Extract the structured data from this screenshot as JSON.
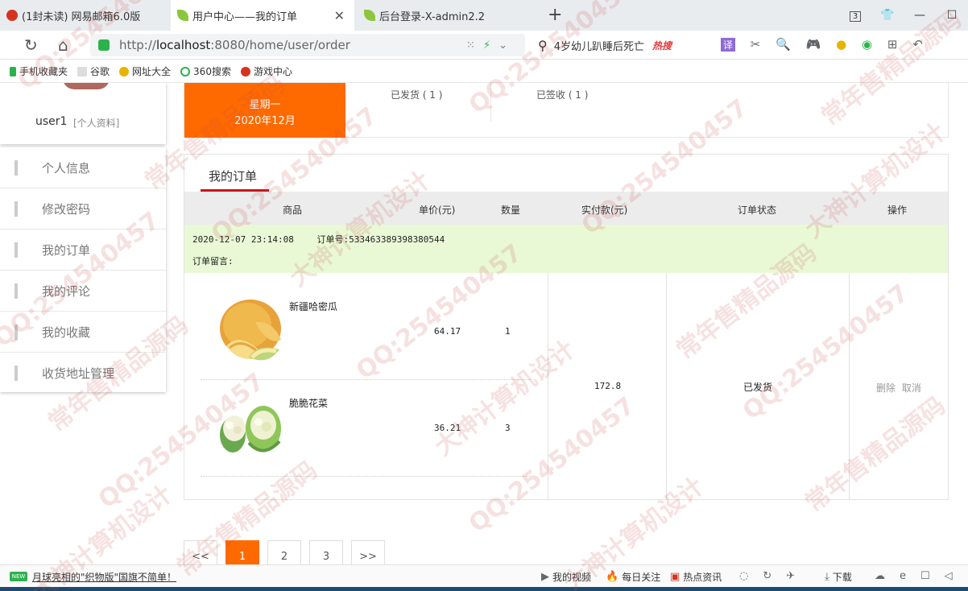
{
  "browser": {
    "tabs": [
      {
        "title": "(1封未读) 网易邮箱6.0版"
      },
      {
        "title": "用户中心——我的订单"
      },
      {
        "title": "后台登录-X-admin2.2"
      }
    ],
    "url_prefix": "http://",
    "url_host": "localhost",
    "url_rest": ":8080/home/user/order",
    "search_text": "4岁幼儿趴睡后死亡",
    "search_hot": "热搜",
    "tab_count": "3",
    "bookmarks": [
      "手机收藏夹",
      "谷歌",
      "网址大全",
      "360搜索",
      "游戏中心"
    ]
  },
  "profile": {
    "username": "user1",
    "profile_link": "[个人资料]"
  },
  "sidebar": {
    "items": [
      {
        "label": "个人信息"
      },
      {
        "label": "修改密码"
      },
      {
        "label": "我的订单"
      },
      {
        "label": "我的评论"
      },
      {
        "label": "我的收藏"
      },
      {
        "label": "收货地址管理"
      }
    ]
  },
  "stats": {
    "weekday": "星期一",
    "month": "2020年12月",
    "shipped": "已发货 ( 1 )",
    "received": "已签收 ( 1 )"
  },
  "orders": {
    "title": "我的订单",
    "headers": {
      "goods": "商品",
      "unit_price": "单价(元)",
      "quantity": "数量",
      "paid": "实付款(元)",
      "status": "订单状态",
      "actions": "操作"
    },
    "order": {
      "datetime": "2020-12-07 23:14:08",
      "order_no_label": "订单号:",
      "order_no": "533463389398380544",
      "note_label": "订单留言:",
      "paid": "172.8",
      "status": "已发货",
      "delete_label": "删除",
      "cancel_label": "取消",
      "items": [
        {
          "name": "新疆哈密瓜",
          "price": "64.17",
          "qty": "1"
        },
        {
          "name": "脆脆花菜",
          "price": "36.21",
          "qty": "3"
        }
      ]
    }
  },
  "pager": {
    "prev": "<<",
    "pages": [
      "1",
      "2",
      "3"
    ],
    "next": ">>"
  },
  "statusbar": {
    "news": "月球亮相的\"织物版\"国旗不简单！",
    "items": [
      "我的视频",
      "每日关注",
      "热点资讯",
      "下载"
    ]
  },
  "watermark": [
    "QQ:254540457",
    "常年售精品源码",
    "大神计算机设计"
  ]
}
